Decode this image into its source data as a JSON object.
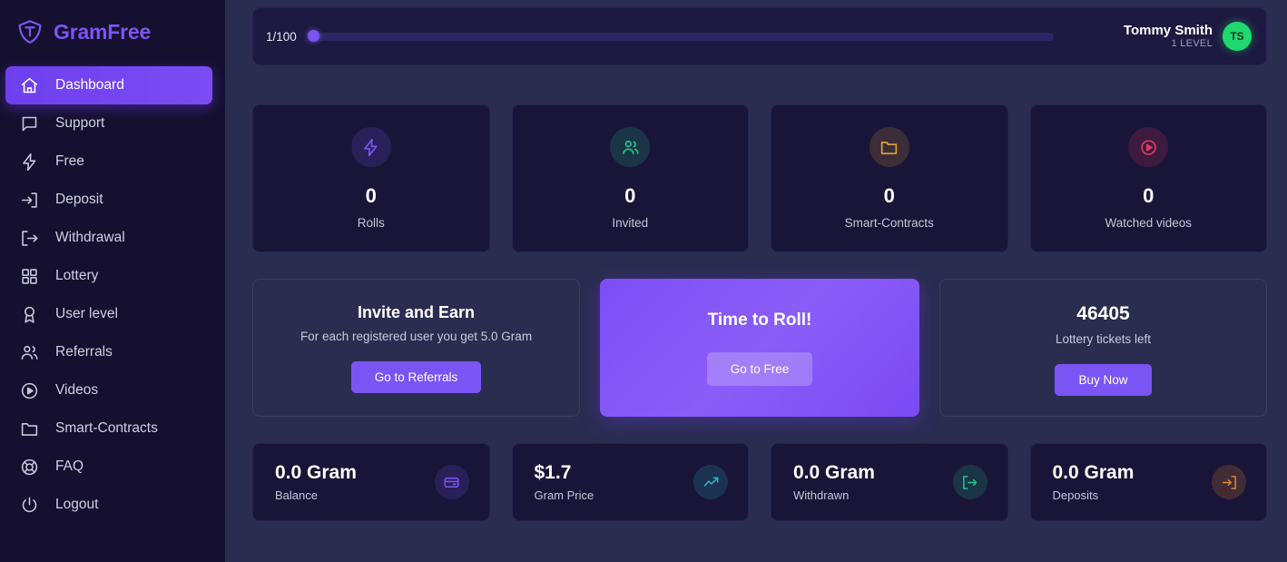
{
  "brand": {
    "name": "GramFree",
    "logo_icon": "gem-shield-icon",
    "logo_color": "#7b55f3"
  },
  "sidebar": {
    "items": [
      {
        "label": "Dashboard",
        "icon": "home-icon",
        "active": true
      },
      {
        "label": "Support",
        "icon": "chat-bubble-icon",
        "active": false
      },
      {
        "label": "Free",
        "icon": "lightning-bolt-icon",
        "active": false
      },
      {
        "label": "Deposit",
        "icon": "arrow-into-box-icon",
        "active": false
      },
      {
        "label": "Withdrawal",
        "icon": "arrow-out-of-box-icon",
        "active": false
      },
      {
        "label": "Lottery",
        "icon": "grid-squares-icon",
        "active": false
      },
      {
        "label": "User level",
        "icon": "award-medal-icon",
        "active": false
      },
      {
        "label": "Referrals",
        "icon": "users-icon",
        "active": false
      },
      {
        "label": "Videos",
        "icon": "play-circle-icon",
        "active": false
      },
      {
        "label": "Smart-Contracts",
        "icon": "folder-icon",
        "active": false
      },
      {
        "label": "FAQ",
        "icon": "lifebuoy-icon",
        "active": false
      },
      {
        "label": "Logout",
        "icon": "power-icon",
        "active": false
      }
    ]
  },
  "topbar": {
    "xp_text": "1/100",
    "xp_percent": 1,
    "user_name": "Tommy Smith",
    "user_level": "1 LEVEL",
    "avatar_initials": "TS",
    "avatar_color": "#1fd96e"
  },
  "stats": [
    {
      "value": "0",
      "label": "Rolls",
      "icon": "lightning-bolt-icon",
      "color": "#7b55f3"
    },
    {
      "value": "0",
      "label": "Invited",
      "icon": "users-icon",
      "color": "#21c98a"
    },
    {
      "value": "0",
      "label": "Smart-Contracts",
      "icon": "folder-icon",
      "color": "#e0a33a"
    },
    {
      "value": "0",
      "label": "Watched videos",
      "icon": "play-circle-icon",
      "color": "#e03a5e"
    }
  ],
  "promos": [
    {
      "title": "Invite and Earn",
      "subtitle": "For each registered user you get 5.0 Gram",
      "button": "Go to Referrals",
      "style": "plain"
    },
    {
      "title": "Time to Roll!",
      "subtitle": "",
      "button": "Go to Free",
      "style": "highlight"
    },
    {
      "title": "46405",
      "subtitle": "Lottery tickets left",
      "button": "Buy Now",
      "style": "lottery"
    }
  ],
  "balances": [
    {
      "value": "0.0 Gram",
      "label": "Balance",
      "icon": "wallet-icon",
      "color": "#7b55f3"
    },
    {
      "value": "$1.7",
      "label": "Gram Price",
      "icon": "trending-up-icon",
      "color": "#2bb7c9"
    },
    {
      "value": "0.0 Gram",
      "label": "Withdrawn",
      "icon": "arrow-out-of-box-icon",
      "color": "#21c98a"
    },
    {
      "value": "0.0 Gram",
      "label": "Deposits",
      "icon": "arrow-into-box-icon",
      "color": "#e0852f"
    }
  ]
}
